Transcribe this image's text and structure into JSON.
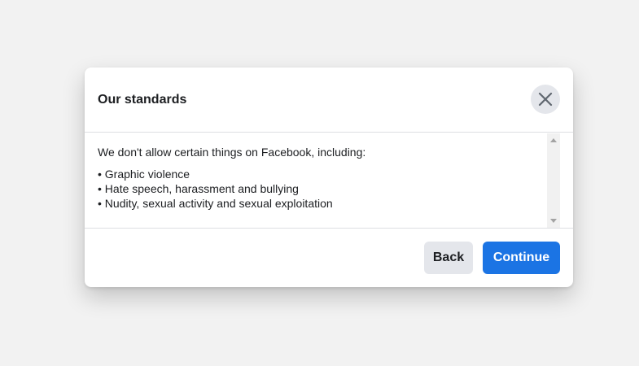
{
  "dialog": {
    "title": "Our standards",
    "close_icon": "close-icon"
  },
  "body": {
    "intro": "We don't allow certain things on Facebook, including:",
    "items": [
      "• Graphic violence",
      "• Hate speech, harassment and bullying",
      "• Nudity, sexual activity and sexual exploitation"
    ]
  },
  "footer": {
    "back_label": "Back",
    "continue_label": "Continue"
  },
  "colors": {
    "background": "#f2f2f2",
    "dialog": "#ffffff",
    "primary": "#1b74e4",
    "secondary_button": "#e4e6eb",
    "text": "#1c1e21",
    "divider": "#dddfe2"
  }
}
